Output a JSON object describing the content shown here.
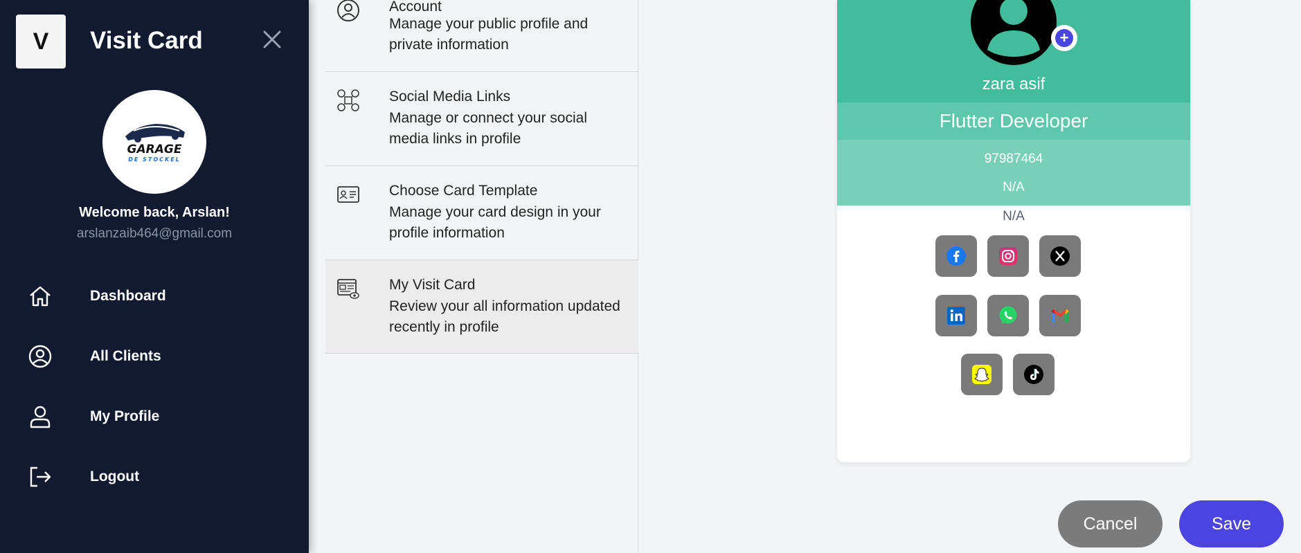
{
  "sidebar": {
    "logo_letter": "V",
    "app_title": "Visit Card",
    "avatar_line1": "GARAGE",
    "avatar_line2": "DE STOCKEL",
    "welcome": "Welcome back, Arslan!",
    "email": "arslanzaib464@gmail.com",
    "nav": [
      {
        "label": "Dashboard",
        "icon": "home-icon"
      },
      {
        "label": "All Clients",
        "icon": "user-circle-icon"
      },
      {
        "label": "My Profile",
        "icon": "user-icon"
      },
      {
        "label": "Logout",
        "icon": "logout-icon"
      }
    ]
  },
  "menu": [
    {
      "title": "Account",
      "desc": "Manage your public profile and private information",
      "icon": "account-icon"
    },
    {
      "title": "Social Media Links",
      "desc": "Manage or connect your social media links in profile",
      "icon": "social-links-icon"
    },
    {
      "title": "Choose Card Template",
      "desc": "Manage your card design in your profile information",
      "icon": "id-card-icon"
    },
    {
      "title": "My Visit Card",
      "desc": "Review your all information updated recently in profile",
      "icon": "visit-card-preview-icon",
      "active": true
    }
  ],
  "card": {
    "name": "zara asif",
    "role": "Flutter Developer",
    "phone": "97987464",
    "field1": "N/A",
    "field2": "N/A",
    "add_symbol": "+",
    "socials": [
      "facebook",
      "instagram",
      "x",
      "linkedin",
      "whatsapp",
      "gmail",
      "snapchat",
      "tiktok"
    ]
  },
  "buttons": {
    "cancel": "Cancel",
    "save": "Save"
  },
  "colors": {
    "sidebar_bg": "#111a2f",
    "card_green": "#43bc9c",
    "accent": "#4b44e0"
  }
}
